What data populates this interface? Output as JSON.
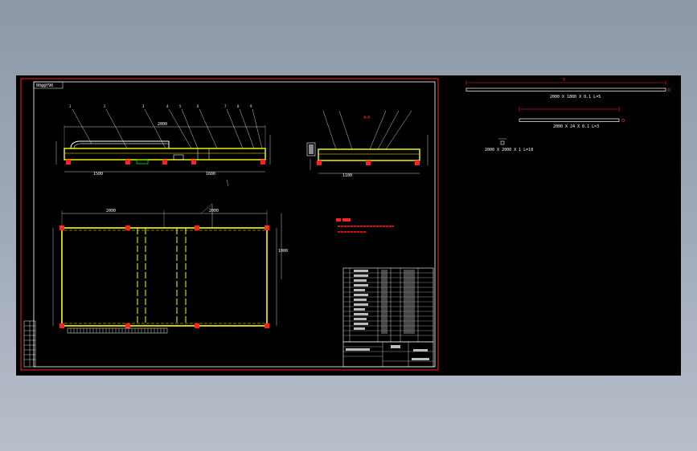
{
  "drawing": {
    "title_tag": "00@@Y90",
    "side_view_label": "A-A",
    "bar1_label": "2000 X 1800 X 0.1 L=5",
    "bar2_label": "2000 X 24 X 0.1 L=3",
    "section_label": "2000 X 2000 X 1 L=10",
    "dims": {
      "top_len": "2000",
      "left_len": "1500",
      "mid_len": "1600",
      "plan_left": "2000",
      "plan_right": "2000",
      "plan_height": "1000",
      "side_len": "1100"
    }
  },
  "colors": {
    "border": "#ff2020",
    "frame": "#ffff00",
    "line": "#ffffff",
    "accent": "#00ffff"
  }
}
